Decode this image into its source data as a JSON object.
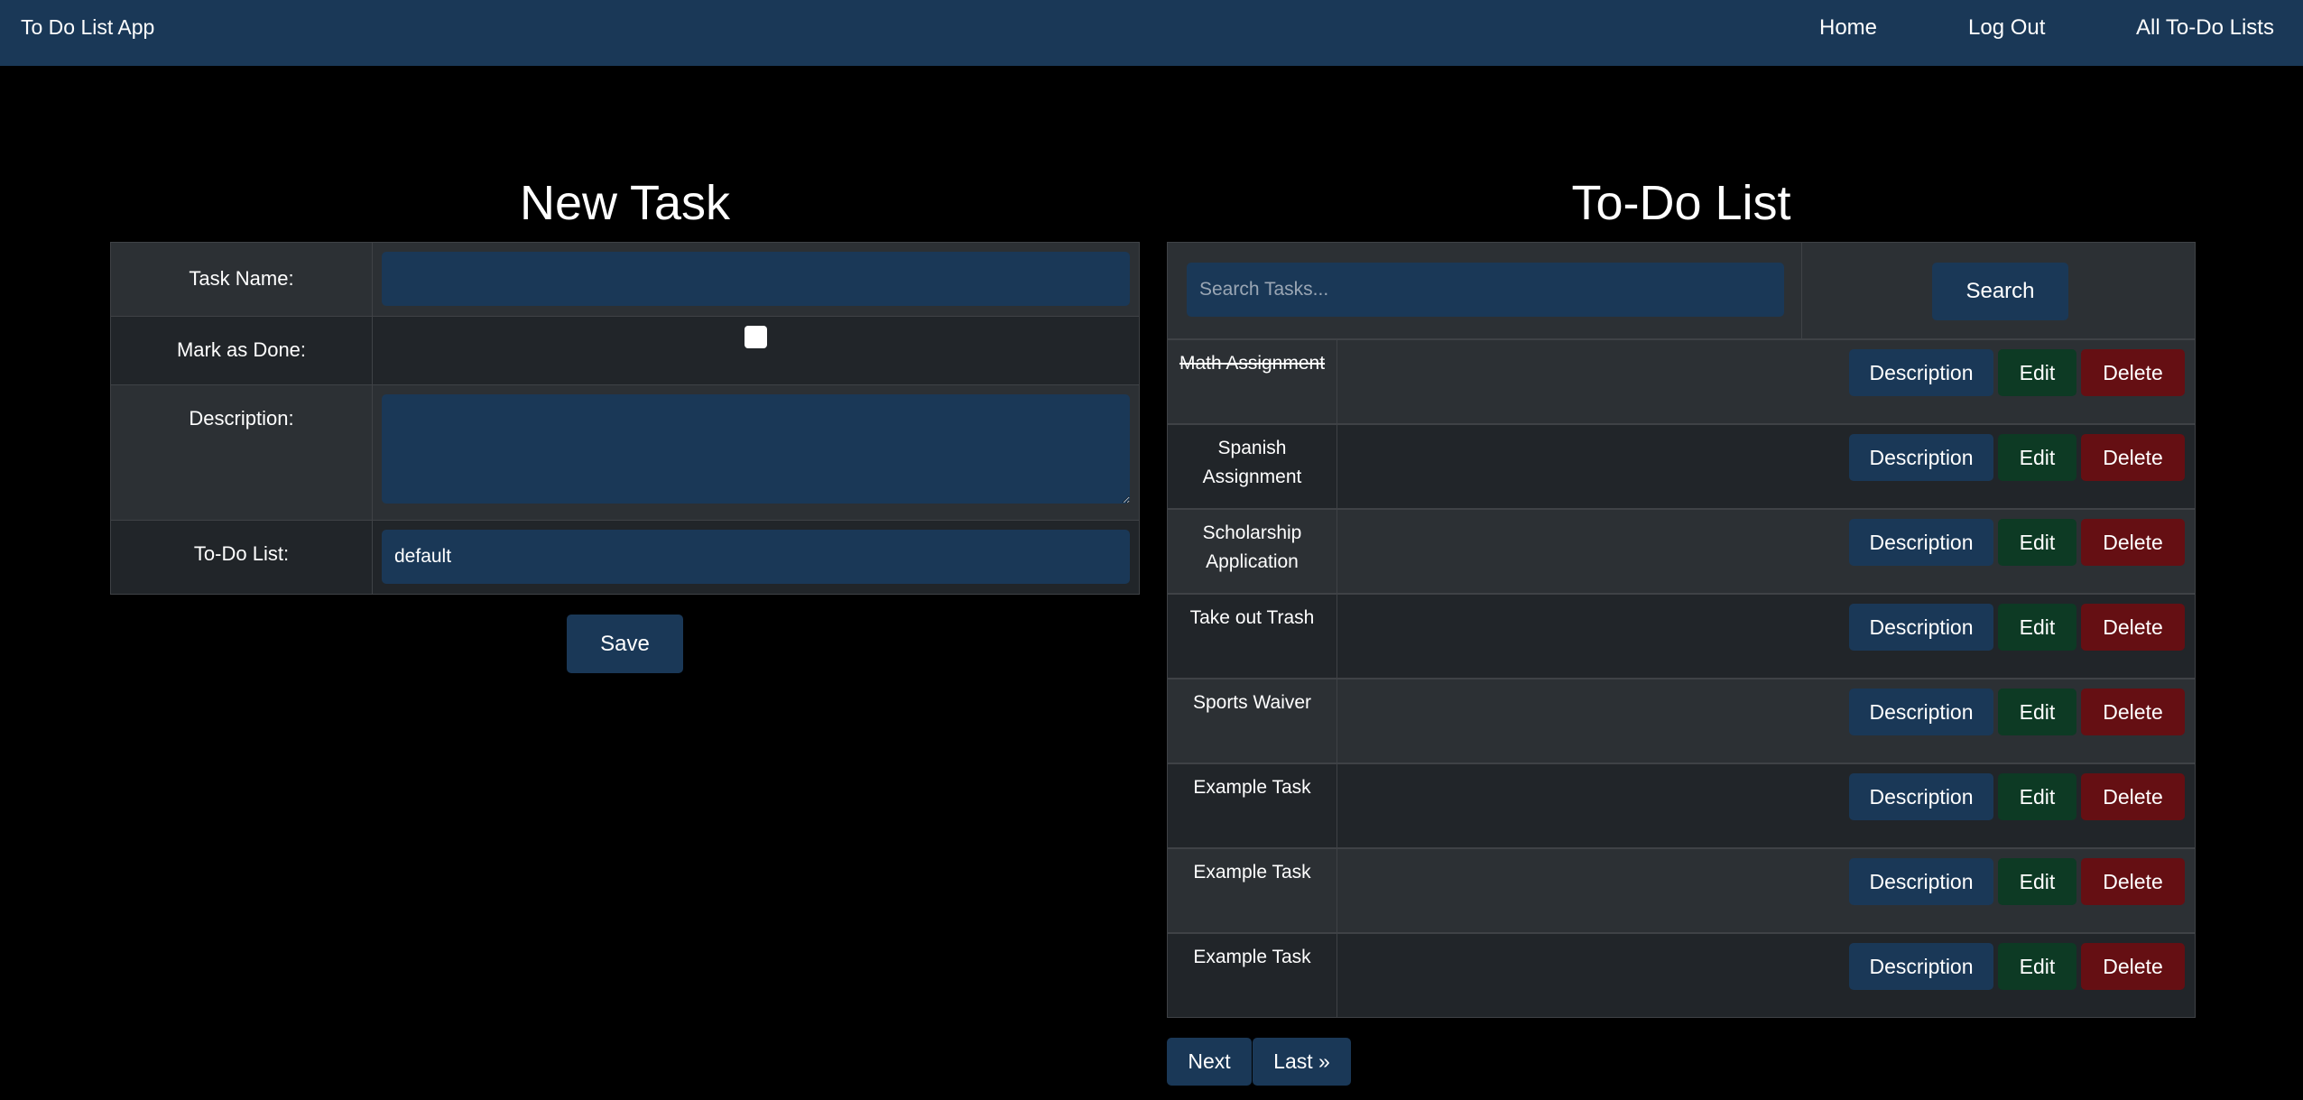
{
  "navbar": {
    "brand": "To Do List App",
    "links": [
      "Home",
      "Log Out",
      "All To-Do Lists"
    ]
  },
  "new_task": {
    "title": "New Task",
    "fields": {
      "task_name_label": "Task Name:",
      "task_name_value": "",
      "mark_done_label": "Mark as Done:",
      "description_label": "Description:",
      "description_value": "",
      "todo_list_label": "To-Do List:",
      "todo_list_value": "default"
    },
    "save_label": "Save"
  },
  "todo_list": {
    "title": "To-Do List",
    "search_placeholder": "Search Tasks...",
    "search_label": "Search",
    "tasks": [
      {
        "name": "Math Assignment",
        "done": true
      },
      {
        "name": "Spanish Assignment",
        "done": false
      },
      {
        "name": "Scholarship Application",
        "done": false
      },
      {
        "name": "Take out Trash",
        "done": false
      },
      {
        "name": "Sports Waiver",
        "done": false
      },
      {
        "name": "Example Task",
        "done": false
      },
      {
        "name": "Example Task",
        "done": false
      },
      {
        "name": "Example Task",
        "done": false
      }
    ],
    "row_buttons": {
      "description": "Description",
      "edit": "Edit",
      "delete": "Delete"
    },
    "pagination": {
      "next": "Next",
      "last": "Last »"
    }
  },
  "colors": {
    "navbar": "#1a3857",
    "primary": "#1a3857",
    "success": "#0d3a24",
    "danger": "#650f13"
  }
}
